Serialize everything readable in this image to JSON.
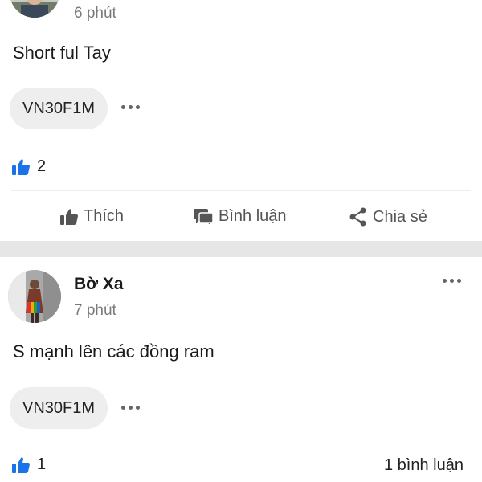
{
  "post1": {
    "time": "6 phút",
    "content": "Short ful Tay",
    "tag": "VN30F1M",
    "likes": "2"
  },
  "actions": {
    "like": "Thích",
    "comment": "Bình luận",
    "share": "Chia sẻ"
  },
  "post2": {
    "author": "Bờ Xa",
    "time": "7 phút",
    "content": "S mạnh lên các đồng ram",
    "tag": "VN30F1M",
    "likes": "1",
    "comments": "1 bình luận"
  },
  "colors": {
    "accent": "#1a73e8",
    "muted": "#7a7a7a",
    "separator": "#e6e6e6"
  }
}
